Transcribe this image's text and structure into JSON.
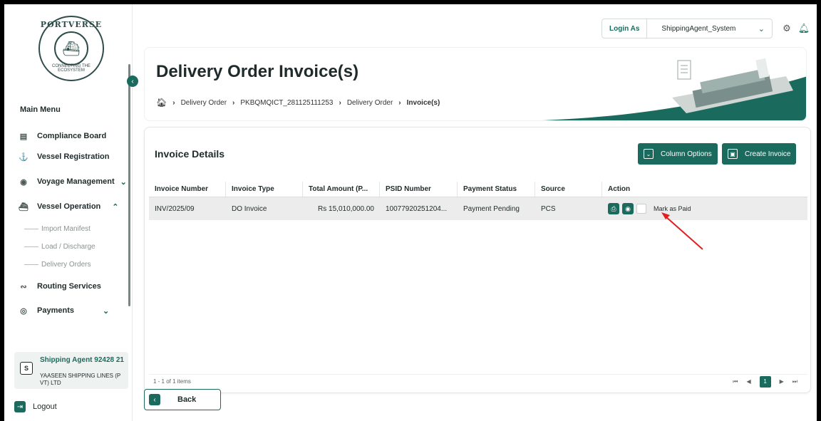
{
  "brand": {
    "logo_top": "PORTVERSE",
    "logo_bottom": "CONNECTING THE ECOSYSTEM"
  },
  "sidebar": {
    "title": "Main Menu",
    "items": [
      {
        "label": "Compliance Board",
        "icon": "board-icon"
      },
      {
        "label": "Vessel Registration",
        "icon": "ship-icon"
      },
      {
        "label": "Voyage Management",
        "icon": "compass-icon"
      },
      {
        "label": "Vessel Operation",
        "icon": "crane-icon"
      },
      {
        "label": "Routing Services",
        "icon": "route-icon"
      },
      {
        "label": "Payments",
        "icon": "payment-icon"
      }
    ],
    "sub_items": [
      "Import Manifest",
      "Load / Discharge",
      "Delivery Orders"
    ],
    "agent": {
      "initial": "S",
      "name": "Shipping Agent 92428 21",
      "company": "YAASEEN SHIPPING LINES (P VT) LTD"
    },
    "logout_label": "Logout"
  },
  "topbar": {
    "login_as": "Login As",
    "role": "ShippingAgent_System"
  },
  "header": {
    "title": "Delivery Order Invoice(s)",
    "breadcrumb": [
      "Delivery Order",
      "PKBQMQICT_281125111253",
      "Delivery Order",
      "Invoice(s)"
    ]
  },
  "panel": {
    "title": "Invoice Details",
    "column_options_label": "Column Options",
    "create_invoice_label": "Create Invoice",
    "columns": [
      "Invoice Number",
      "Invoice Type",
      "Total Amount (P...",
      "PSID Number",
      "Payment Status",
      "Source",
      "Action"
    ],
    "rows": [
      {
        "invoice_number": "INV/2025/09",
        "invoice_type": "DO Invoice",
        "total_amount": "Rs 15,010,000.00",
        "psid": "10077920251204...",
        "payment_status": "Payment Pending",
        "source": "PCS",
        "mark_label": "Mark as Paid"
      }
    ],
    "pager_info": "1 - 1 of 1 items",
    "page": "1"
  },
  "footer": {
    "back_label": "Back"
  },
  "colors": {
    "accent": "#1a6b5e",
    "row_bg": "#ececec",
    "arrow": "#e02020"
  }
}
